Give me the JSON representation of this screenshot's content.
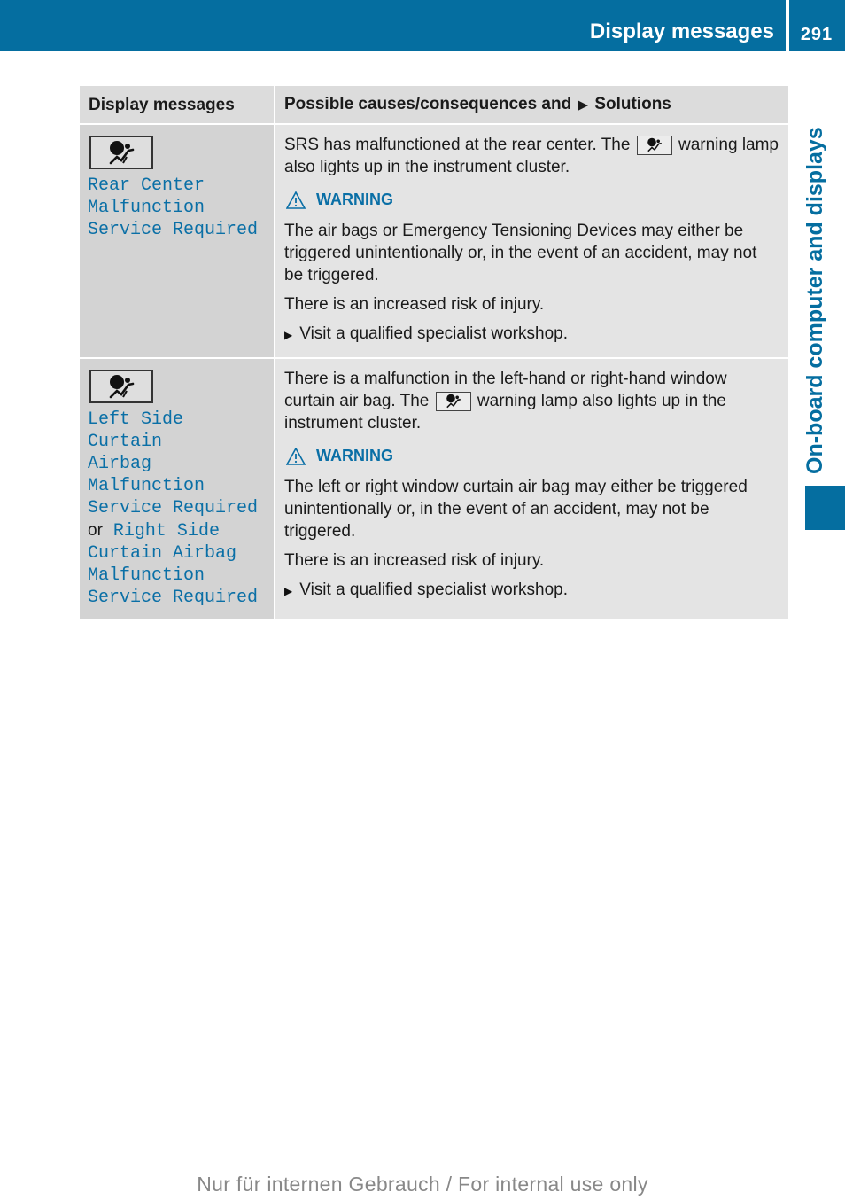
{
  "header": {
    "section_title": "Display messages",
    "page_number": "291"
  },
  "side_tab": {
    "label": "On-board computer and displays"
  },
  "table": {
    "columns": {
      "col1": "Display messages",
      "col2_prefix": "Possible causes/consequences and",
      "col2_arrow": "▶",
      "col2_suffix": "Solutions"
    },
    "rows": [
      {
        "icon": "airbag-warning-lamp-icon",
        "message_lines": [
          "Rear Center",
          "Malfunction",
          "Service Required"
        ],
        "cause_before_icon": "SRS has malfunctioned at the rear center. The",
        "cause_after_icon": "warning lamp also lights up in the instrument cluster.",
        "warning_label": "WARNING",
        "warning_text": "The air bags or Emergency Tensioning Devices may either be triggered unintentionally or, in the event of an accident, may not be triggered.",
        "risk_text": "There is an increased risk of injury.",
        "solution": "Visit a qualified specialist workshop."
      },
      {
        "icon": "airbag-warning-lamp-icon",
        "message_lines_a": [
          "Left Side Curtain",
          "Airbag Malfunction",
          "Service Required"
        ],
        "or_word": "or",
        "message_lines_b_first": "Right Side",
        "message_lines_b": [
          "Curtain Airbag",
          "Malfunction",
          "Service Required"
        ],
        "cause_before_icon": "There is a malfunction in the left-hand or right-hand window curtain air bag. The",
        "cause_after_icon": "warning lamp also lights up in the instrument cluster.",
        "warning_label": "WARNING",
        "warning_text": "The left or right window curtain air bag may either be triggered unintentionally or, in the event of an accident, may not be triggered.",
        "risk_text": "There is an increased risk of injury.",
        "solution": "Visit a qualified specialist workshop."
      }
    ]
  },
  "step_arrow": "▶",
  "footer": {
    "note": "Nur für internen Gebrauch / For internal use only"
  },
  "colors": {
    "brand_blue": "#056ea0",
    "message_blue": "#0a6fa6"
  }
}
